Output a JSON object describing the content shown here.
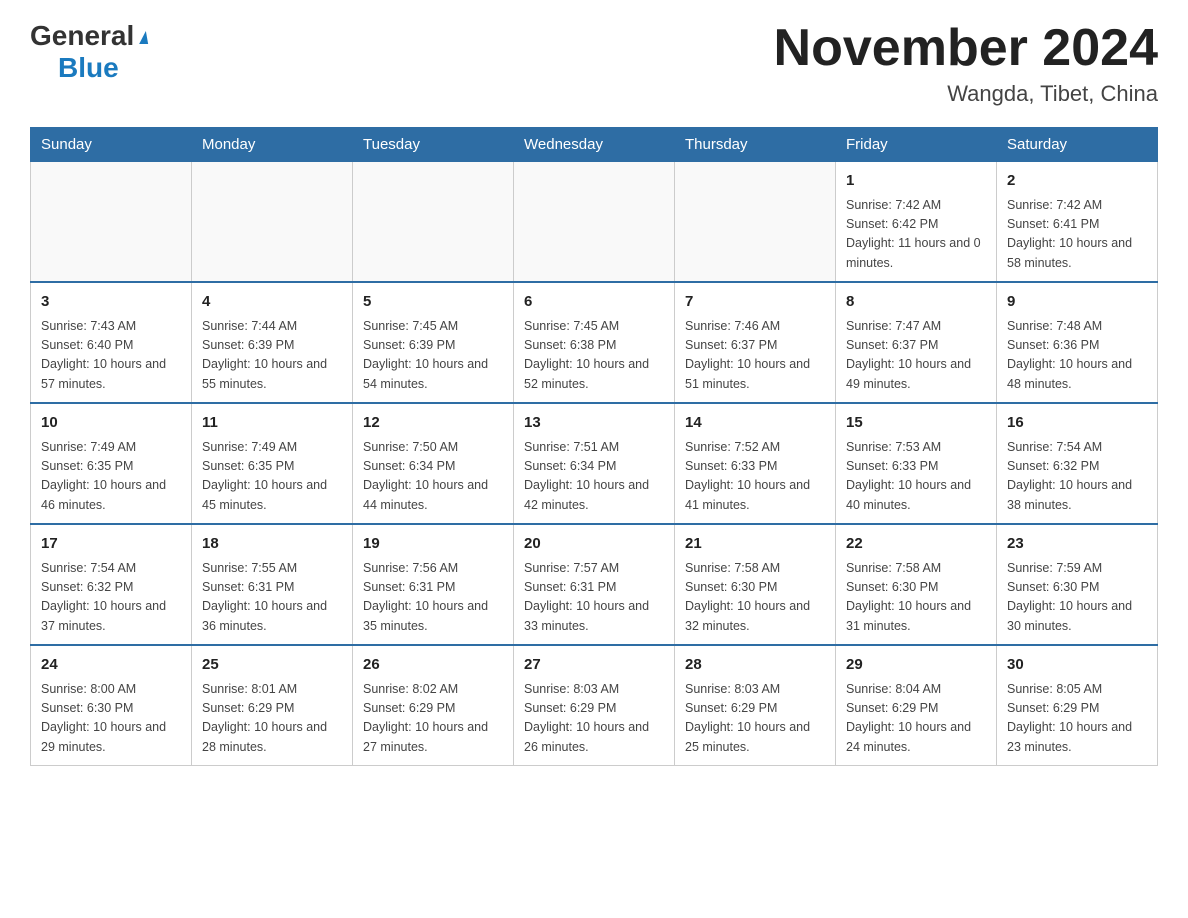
{
  "logo": {
    "general": "General",
    "blue": "Blue",
    "arrow": "▶"
  },
  "title": "November 2024",
  "subtitle": "Wangda, Tibet, China",
  "days_of_week": [
    "Sunday",
    "Monday",
    "Tuesday",
    "Wednesday",
    "Thursday",
    "Friday",
    "Saturday"
  ],
  "weeks": [
    [
      {
        "day": "",
        "info": ""
      },
      {
        "day": "",
        "info": ""
      },
      {
        "day": "",
        "info": ""
      },
      {
        "day": "",
        "info": ""
      },
      {
        "day": "",
        "info": ""
      },
      {
        "day": "1",
        "info": "Sunrise: 7:42 AM\nSunset: 6:42 PM\nDaylight: 11 hours and 0 minutes."
      },
      {
        "day": "2",
        "info": "Sunrise: 7:42 AM\nSunset: 6:41 PM\nDaylight: 10 hours and 58 minutes."
      }
    ],
    [
      {
        "day": "3",
        "info": "Sunrise: 7:43 AM\nSunset: 6:40 PM\nDaylight: 10 hours and 57 minutes."
      },
      {
        "day": "4",
        "info": "Sunrise: 7:44 AM\nSunset: 6:39 PM\nDaylight: 10 hours and 55 minutes."
      },
      {
        "day": "5",
        "info": "Sunrise: 7:45 AM\nSunset: 6:39 PM\nDaylight: 10 hours and 54 minutes."
      },
      {
        "day": "6",
        "info": "Sunrise: 7:45 AM\nSunset: 6:38 PM\nDaylight: 10 hours and 52 minutes."
      },
      {
        "day": "7",
        "info": "Sunrise: 7:46 AM\nSunset: 6:37 PM\nDaylight: 10 hours and 51 minutes."
      },
      {
        "day": "8",
        "info": "Sunrise: 7:47 AM\nSunset: 6:37 PM\nDaylight: 10 hours and 49 minutes."
      },
      {
        "day": "9",
        "info": "Sunrise: 7:48 AM\nSunset: 6:36 PM\nDaylight: 10 hours and 48 minutes."
      }
    ],
    [
      {
        "day": "10",
        "info": "Sunrise: 7:49 AM\nSunset: 6:35 PM\nDaylight: 10 hours and 46 minutes."
      },
      {
        "day": "11",
        "info": "Sunrise: 7:49 AM\nSunset: 6:35 PM\nDaylight: 10 hours and 45 minutes."
      },
      {
        "day": "12",
        "info": "Sunrise: 7:50 AM\nSunset: 6:34 PM\nDaylight: 10 hours and 44 minutes."
      },
      {
        "day": "13",
        "info": "Sunrise: 7:51 AM\nSunset: 6:34 PM\nDaylight: 10 hours and 42 minutes."
      },
      {
        "day": "14",
        "info": "Sunrise: 7:52 AM\nSunset: 6:33 PM\nDaylight: 10 hours and 41 minutes."
      },
      {
        "day": "15",
        "info": "Sunrise: 7:53 AM\nSunset: 6:33 PM\nDaylight: 10 hours and 40 minutes."
      },
      {
        "day": "16",
        "info": "Sunrise: 7:54 AM\nSunset: 6:32 PM\nDaylight: 10 hours and 38 minutes."
      }
    ],
    [
      {
        "day": "17",
        "info": "Sunrise: 7:54 AM\nSunset: 6:32 PM\nDaylight: 10 hours and 37 minutes."
      },
      {
        "day": "18",
        "info": "Sunrise: 7:55 AM\nSunset: 6:31 PM\nDaylight: 10 hours and 36 minutes."
      },
      {
        "day": "19",
        "info": "Sunrise: 7:56 AM\nSunset: 6:31 PM\nDaylight: 10 hours and 35 minutes."
      },
      {
        "day": "20",
        "info": "Sunrise: 7:57 AM\nSunset: 6:31 PM\nDaylight: 10 hours and 33 minutes."
      },
      {
        "day": "21",
        "info": "Sunrise: 7:58 AM\nSunset: 6:30 PM\nDaylight: 10 hours and 32 minutes."
      },
      {
        "day": "22",
        "info": "Sunrise: 7:58 AM\nSunset: 6:30 PM\nDaylight: 10 hours and 31 minutes."
      },
      {
        "day": "23",
        "info": "Sunrise: 7:59 AM\nSunset: 6:30 PM\nDaylight: 10 hours and 30 minutes."
      }
    ],
    [
      {
        "day": "24",
        "info": "Sunrise: 8:00 AM\nSunset: 6:30 PM\nDaylight: 10 hours and 29 minutes."
      },
      {
        "day": "25",
        "info": "Sunrise: 8:01 AM\nSunset: 6:29 PM\nDaylight: 10 hours and 28 minutes."
      },
      {
        "day": "26",
        "info": "Sunrise: 8:02 AM\nSunset: 6:29 PM\nDaylight: 10 hours and 27 minutes."
      },
      {
        "day": "27",
        "info": "Sunrise: 8:03 AM\nSunset: 6:29 PM\nDaylight: 10 hours and 26 minutes."
      },
      {
        "day": "28",
        "info": "Sunrise: 8:03 AM\nSunset: 6:29 PM\nDaylight: 10 hours and 25 minutes."
      },
      {
        "day": "29",
        "info": "Sunrise: 8:04 AM\nSunset: 6:29 PM\nDaylight: 10 hours and 24 minutes."
      },
      {
        "day": "30",
        "info": "Sunrise: 8:05 AM\nSunset: 6:29 PM\nDaylight: 10 hours and 23 minutes."
      }
    ]
  ]
}
